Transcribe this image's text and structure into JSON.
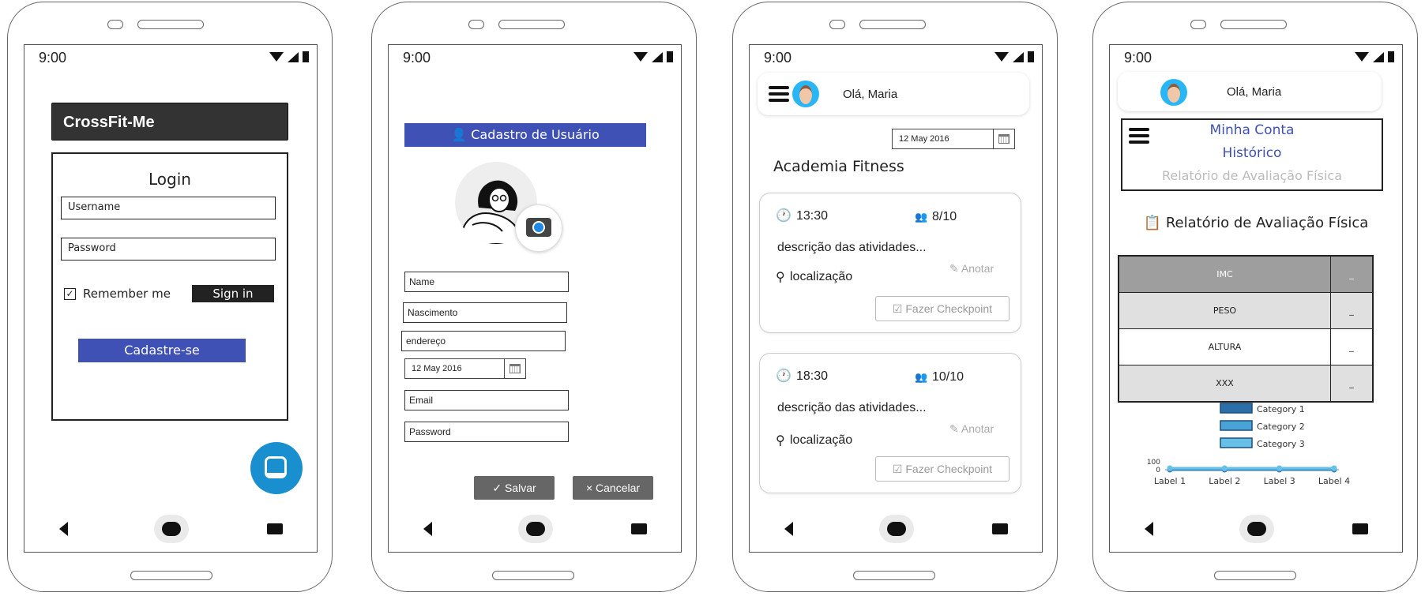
{
  "status": {
    "time": "9:00"
  },
  "login": {
    "brand": "CrossFit-Me",
    "title": "Login",
    "username_placeholder": "Username",
    "password_placeholder": "Password",
    "remember_label": "Remember me",
    "signin_label": "Sign in",
    "register_label": "Cadastre-se"
  },
  "register": {
    "title": "Cadastro de Usuário",
    "fields": {
      "name": "Name",
      "birth": "Nascimento",
      "address": "endereço",
      "date": "12 May 2016",
      "email": "Email",
      "password": "Password"
    },
    "save_label": "Salvar",
    "cancel_label": "Cancelar"
  },
  "classes": {
    "greeting": "Olá, Maria",
    "date": "12 May 2016",
    "gym_name": "Academia Fitness",
    "cards": [
      {
        "time": "13:30",
        "capacity": "8/10",
        "description": "descrição  das atividades...",
        "location": "localização",
        "note_label": "Anotar",
        "checkpoint_label": "Fazer Checkpoint"
      },
      {
        "time": "18:30",
        "capacity": "10/10",
        "description": "descrição  das atividades...",
        "location": "localização",
        "note_label": "Anotar",
        "checkpoint_label": "Fazer Checkpoint"
      }
    ]
  },
  "report": {
    "greeting": "Olá, Maria",
    "menu": {
      "item_account": "Minha Conta",
      "item_history": "Histórico",
      "item_report": "Relatório de Avaliação Física"
    },
    "title": "Relatório de Avaliação Física",
    "rows": [
      {
        "label": "IMC",
        "value": "_"
      },
      {
        "label": "PESO",
        "value": "_"
      },
      {
        "label": "ALTURA",
        "value": "_"
      },
      {
        "label": "XXX",
        "value": "_"
      }
    ]
  },
  "chart_data": {
    "type": "line",
    "categories": [
      "Label 1",
      "Label 2",
      "Label 3",
      "Label 4"
    ],
    "series": [
      {
        "name": "Category 1",
        "values": [
          0,
          0,
          0,
          0
        ]
      },
      {
        "name": "Category 2",
        "values": [
          0,
          0,
          0,
          0
        ]
      },
      {
        "name": "Category 3",
        "values": [
          0,
          0,
          0,
          0
        ]
      }
    ],
    "ylim": [
      0,
      100
    ],
    "yticks": [
      "100",
      "0"
    ],
    "legend": "top",
    "colors": [
      "#2c6fa8",
      "#4aa3d6",
      "#67c0e8"
    ]
  },
  "colors": {
    "accent": "#3f51b5",
    "chat": "#1a8fd0",
    "dark": "#333333"
  }
}
